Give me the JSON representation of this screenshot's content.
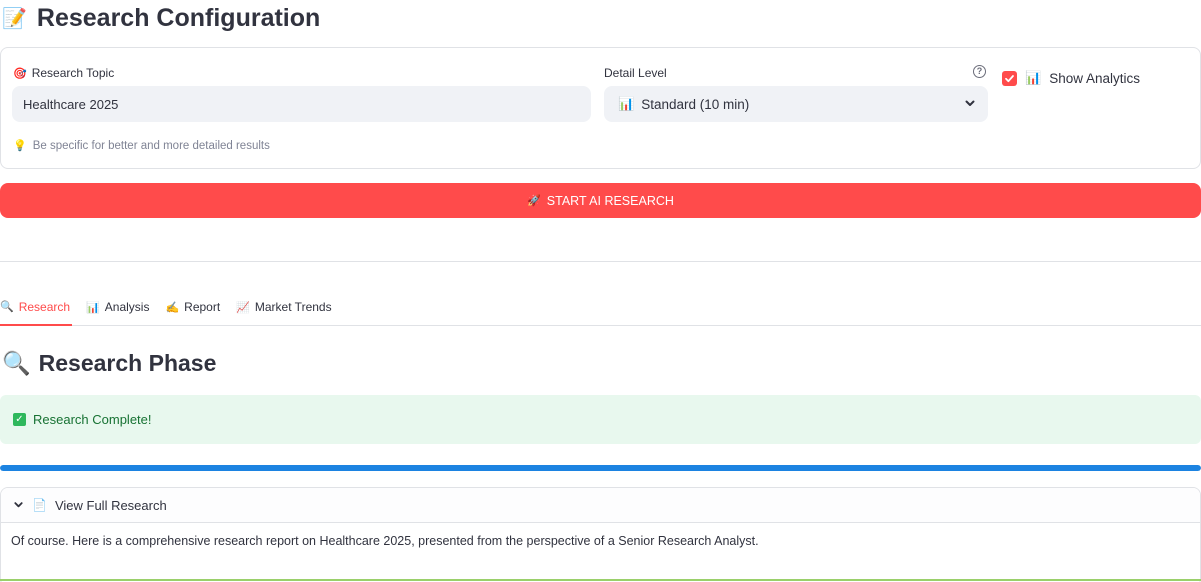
{
  "header": {
    "icon": "memo-icon",
    "title": "Research Configuration"
  },
  "config": {
    "topic": {
      "label": "Research Topic",
      "value": "Healthcare 2025"
    },
    "detail": {
      "label": "Detail Level",
      "selected": "Standard (10 min)"
    },
    "help_glyph": "?",
    "analytics": {
      "label": "Show Analytics",
      "checked": true
    },
    "hint": "Be specific for better and more detailed results"
  },
  "start_button": {
    "label": "START AI RESEARCH"
  },
  "tabs": [
    {
      "label": "Research",
      "icon": "magnifier-icon",
      "active": true
    },
    {
      "label": "Analysis",
      "icon": "bar-chart-icon",
      "active": false
    },
    {
      "label": "Report",
      "icon": "writing-hand-icon",
      "active": false
    },
    {
      "label": "Market Trends",
      "icon": "chart-increasing-icon",
      "active": false
    }
  ],
  "phase": {
    "title": "Research Phase",
    "status": "Research Complete!",
    "progress": 1.0
  },
  "expander": {
    "label": "View Full Research",
    "body": "Of course. Here is a comprehensive research report on Healthcare 2025, presented from the perspective of a Senior Research Analyst."
  },
  "colors": {
    "primary": "#ff4b4b",
    "progress": "#1c83e1",
    "success_bg": "#e8f8ee",
    "success_text": "#177233"
  }
}
